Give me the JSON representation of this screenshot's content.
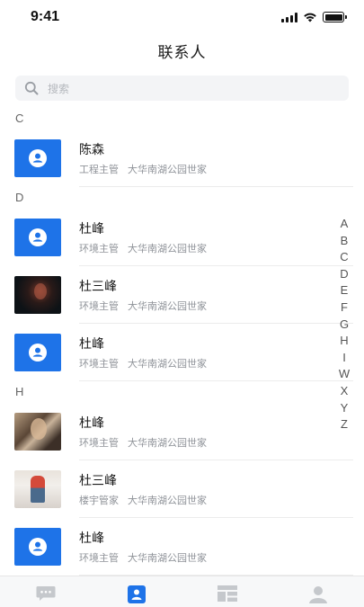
{
  "status_bar": {
    "time": "9:41",
    "icons": [
      "signal-icon",
      "wifi-icon",
      "battery-icon"
    ]
  },
  "navbar": {
    "title": "联系人"
  },
  "search": {
    "placeholder": "搜索",
    "icon": "search-icon"
  },
  "colors": {
    "accent": "#1e73e8",
    "avatar_blue": "#1e73e8",
    "tab_active": "#1e73e8",
    "tab_inactive": "#c5c8cc"
  },
  "sections": [
    {
      "letter": "C",
      "contacts": [
        {
          "name": "陈森",
          "role": "工程主管",
          "location": "大华南湖公园世家",
          "avatar": "default-avatar-icon"
        }
      ]
    },
    {
      "letter": "D",
      "contacts": [
        {
          "name": "杜峰",
          "role": "环境主管",
          "location": "大华南湖公园世家",
          "avatar": "default-avatar-icon"
        },
        {
          "name": "杜三峰",
          "role": "环境主管",
          "location": "大华南湖公园世家",
          "avatar": "photo-avatar-dark"
        },
        {
          "name": "杜峰",
          "role": "环境主管",
          "location": "大华南湖公园世家",
          "avatar": "default-avatar-icon"
        }
      ]
    },
    {
      "letter": "H",
      "contacts": [
        {
          "name": "杜峰",
          "role": "环境主管",
          "location": "大华南湖公园世家",
          "avatar": "photo-avatar-grain"
        },
        {
          "name": "杜三峰",
          "role": "楼宇管家",
          "location": "大华南湖公园世家",
          "avatar": "photo-avatar-light"
        },
        {
          "name": "杜峰",
          "role": "环境主管",
          "location": "大华南湖公园世家",
          "avatar": "default-avatar-icon"
        }
      ]
    }
  ],
  "index_letters": [
    "A",
    "B",
    "C",
    "D",
    "E",
    "F",
    "G",
    "H",
    "I",
    "W",
    "X",
    "Y",
    "Z"
  ],
  "tab_bar": [
    {
      "icon": "message-icon",
      "active": false
    },
    {
      "icon": "contacts-icon",
      "active": true
    },
    {
      "icon": "dashboard-icon",
      "active": false
    },
    {
      "icon": "profile-icon",
      "active": false
    }
  ]
}
